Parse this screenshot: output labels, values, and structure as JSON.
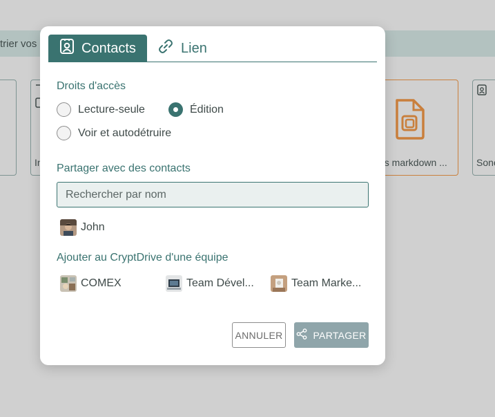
{
  "background": {
    "toolbar_text": "trier vos",
    "cards": [
      {
        "label": ""
      },
      {
        "label": "In"
      },
      {
        "label": "es markdown ..."
      },
      {
        "label": "Sone"
      }
    ]
  },
  "modal": {
    "tabs": [
      {
        "label": "Contacts",
        "icon": "contact-card-icon",
        "active": true
      },
      {
        "label": "Lien",
        "icon": "link-icon",
        "active": false
      }
    ],
    "access": {
      "title": "Droits d'accès",
      "options": [
        {
          "label": "Lecture-seule",
          "checked": false
        },
        {
          "label": "Édition",
          "checked": true
        },
        {
          "label": "Voir et autodétruire",
          "checked": false
        }
      ]
    },
    "share_contacts": {
      "title": "Partager avec des contacts",
      "search_placeholder": "Rechercher par nom",
      "contacts": [
        {
          "name": "John"
        }
      ]
    },
    "teams": {
      "title": "Ajouter au CryptDrive d'une équipe",
      "items": [
        {
          "name": "COMEX"
        },
        {
          "name": "Team Dével..."
        },
        {
          "name": "Team Marke..."
        }
      ]
    },
    "buttons": {
      "cancel": "ANNULER",
      "share": "PARTAGER"
    }
  },
  "colors": {
    "accent": "#3a7370",
    "share_button": "#8fa5aa",
    "overlay": "#d0d0d0",
    "doc_orange": "#c97f3c"
  }
}
